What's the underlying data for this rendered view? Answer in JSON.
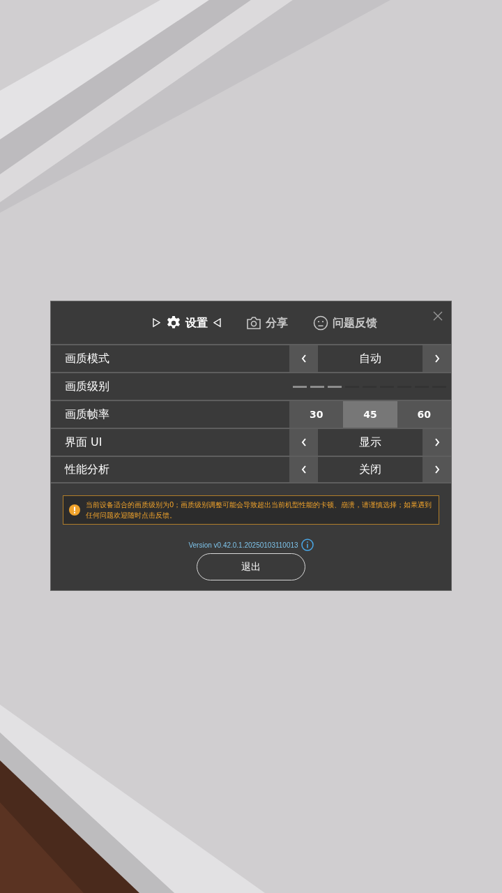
{
  "tabs": [
    {
      "label": "设置",
      "selected": true
    },
    {
      "label": "分享",
      "selected": false
    },
    {
      "label": "问题反馈",
      "selected": false
    }
  ],
  "settings": [
    {
      "kind": "stepper",
      "label": "画质模式",
      "value": "自动"
    },
    {
      "kind": "meter",
      "label": "画质级别",
      "level": 0.333
    },
    {
      "kind": "segmented",
      "label": "画质帧率",
      "options": [
        {
          "label": "30",
          "selected": false
        },
        {
          "label": "45",
          "selected": true
        },
        {
          "label": "60",
          "selected": false
        }
      ]
    },
    {
      "kind": "stepper",
      "label": "界面 UI",
      "value": "显示"
    },
    {
      "kind": "stepper",
      "label": "性能分析",
      "value": "关闭"
    }
  ],
  "notice": "当前设备适合的画质级别为0；画质级别调整可能会导致超出当前机型性能的卡顿、崩溃，请谨慎选择；如果遇到任何问题欢迎随时点击反馈。",
  "version": "Version v0.42.0.1.20250103110013",
  "exit_button": "退出"
}
